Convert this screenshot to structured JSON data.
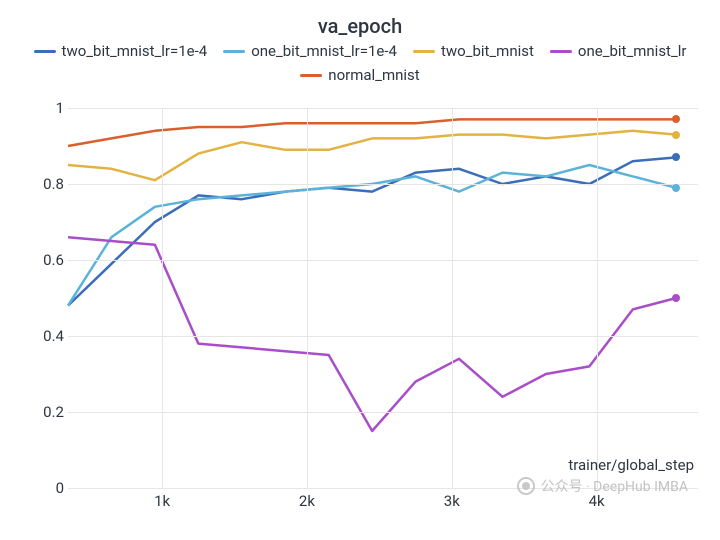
{
  "title": "va_epoch",
  "xlabel": "trainer/global_step",
  "watermark": "公众号 · DeepHub IMBA",
  "chart_data": {
    "type": "line",
    "xlim": [
      350,
      4700
    ],
    "ylim": [
      0,
      1
    ],
    "x_ticks": [
      1000,
      2000,
      3000,
      4000
    ],
    "x_tick_labels": [
      "1k",
      "2k",
      "3k",
      "4k"
    ],
    "y_ticks": [
      0,
      0.2,
      0.4,
      0.6,
      0.8,
      1
    ],
    "categories": [
      350,
      650,
      950,
      1250,
      1550,
      1850,
      2150,
      2450,
      2750,
      3050,
      3350,
      3650,
      3950,
      4250,
      4550
    ],
    "series": [
      {
        "name": "two_bit_mnist_lr=1e-4",
        "color": "#3b6db8",
        "values": [
          0.48,
          0.59,
          0.7,
          0.77,
          0.76,
          0.78,
          0.79,
          0.78,
          0.83,
          0.84,
          0.8,
          0.82,
          0.8,
          0.86,
          0.87
        ]
      },
      {
        "name": "one_bit_mnist_lr=1e-4",
        "color": "#5cb3d9",
        "values": [
          0.48,
          0.66,
          0.74,
          0.76,
          0.77,
          0.78,
          0.79,
          0.8,
          0.82,
          0.78,
          0.83,
          0.82,
          0.85,
          0.82,
          0.79
        ]
      },
      {
        "name": "two_bit_mnist",
        "color": "#e3b341",
        "values": [
          0.85,
          0.84,
          0.81,
          0.88,
          0.91,
          0.89,
          0.89,
          0.92,
          0.92,
          0.93,
          0.93,
          0.92,
          0.93,
          0.94,
          0.93
        ]
      },
      {
        "name": "one_bit_mnist_lr",
        "color": "#a94dc9",
        "values": [
          0.66,
          0.65,
          0.64,
          0.38,
          0.37,
          0.36,
          0.35,
          0.15,
          0.28,
          0.34,
          0.24,
          0.3,
          0.32,
          0.47,
          0.5
        ]
      },
      {
        "name": "normal_mnist",
        "color": "#d9602c",
        "values": [
          0.9,
          0.92,
          0.94,
          0.95,
          0.95,
          0.96,
          0.96,
          0.96,
          0.96,
          0.97,
          0.97,
          0.97,
          0.97,
          0.97,
          0.97
        ]
      }
    ]
  }
}
